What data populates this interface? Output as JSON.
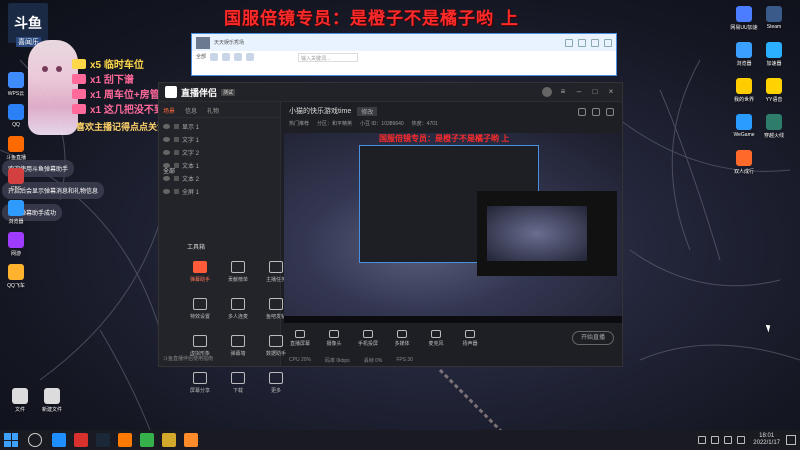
{
  "banner": {
    "text": "国服倍镜专员：是橙子不是橘子哟    上"
  },
  "overlay": {
    "logo": "斗鱼",
    "logo_sub": "喜闻乐",
    "lines": [
      {
        "text": "x5 临时车位",
        "color": "#ffd84a",
        "icon": "gift-icon"
      },
      {
        "text": "x1 刮下谱",
        "color": "#ff6a9a",
        "icon": "gift-icon"
      },
      {
        "text": "x1 周车位+房管",
        "color": "#ff6a9a",
        "icon": "gift-icon"
      },
      {
        "text": "x1 这几把没不到吖",
        "color": "#ff6a9a",
        "icon": "gift-icon"
      }
    ],
    "follow": "喜欢主播记得点点关注呦~❤"
  },
  "chat_bubbles": [
    "欢迎使用斗鱼弹幕助手",
    "开启后会显示弹幕消息和礼物信息",
    "添加弹幕助手成功"
  ],
  "desktop_left": [
    {
      "label": "WPS云",
      "color": "#3f8cff"
    },
    {
      "label": "QQ",
      "color": "#2b80f5"
    },
    {
      "label": "斗鱼直播",
      "color": "#ff6a00"
    },
    {
      "label": "CBS",
      "color": "#d24040"
    },
    {
      "label": "浏览器",
      "color": "#2e9cff"
    },
    {
      "label": "网游",
      "color": "#a03cff"
    },
    {
      "label": "QQ飞车",
      "color": "#ffb22e"
    }
  ],
  "desktop_right": [
    {
      "label": "网易UU加速",
      "color": "#4a7dff"
    },
    {
      "label": "Steam",
      "color": "#3a5a8a"
    },
    {
      "label": "浏览器",
      "color": "#3aa0ff"
    },
    {
      "label": "加速器",
      "color": "#2bb0ff"
    },
    {
      "label": "我的世界",
      "color": "#ffcc00"
    },
    {
      "label": "YY语音",
      "color": "#ffd200"
    },
    {
      "label": "WeGame",
      "color": "#2a9cff"
    },
    {
      "label": "穿越火线",
      "color": "#2e7d6a"
    },
    {
      "label": "双人成行",
      "color": "#ff6a2a"
    }
  ],
  "desktop_bottom": [
    {
      "label": "文件",
      "color": "#dcdcdc"
    },
    {
      "label": "新建文件",
      "color": "#dcdcdc"
    }
  ],
  "fish": {
    "title": "天天娱乐秀场",
    "search_placeholder": "输入关键词...",
    "label_tool": "全部"
  },
  "app": {
    "name": "直播伴侣",
    "version": "测试",
    "left_tabs": [
      "场景",
      "信息",
      "礼物"
    ],
    "scenes": [
      "显示 1",
      "文字 1",
      "文字 2",
      "文本 1",
      "文本 2",
      "全屏 1"
    ],
    "full_label": "全部",
    "tools_head": "工具箱",
    "tools": [
      {
        "label": "弹幕助手",
        "red": true
      },
      {
        "label": "贡献榜单",
        "red": false
      },
      {
        "label": "主播任务",
        "red": false
      },
      {
        "label": "特效设置",
        "red": false
      },
      {
        "label": "多人连麦",
        "red": false
      },
      {
        "label": "鱼吧发帖",
        "red": false
      },
      {
        "label": "虚拟形象",
        "red": false
      },
      {
        "label": "弹幕墙",
        "red": false
      },
      {
        "label": "数据助手",
        "red": false
      },
      {
        "label": "屏幕分享",
        "red": false
      },
      {
        "label": "下载",
        "red": false
      },
      {
        "label": "更多",
        "red": false
      }
    ],
    "left_footer": "斗鱼直播伴侣使用指南",
    "room_title": "小猫的快乐游戏time",
    "room_tag": "修改",
    "room_meta": [
      "热门推荐",
      "分区：和平精英",
      "小豆 ID：10389640",
      "热度：4701"
    ],
    "bottom_items": [
      "直播屏幕",
      "摄像头",
      "手机投屏",
      "多媒体",
      "麦克风",
      "扬声器"
    ],
    "live_button": "开始直播",
    "status": [
      "CPU 20%",
      "码率 0kbps",
      "丢帧 0%",
      "FPS 30"
    ]
  },
  "taskbar": {
    "time": "18:01",
    "date": "2022/1/17",
    "apps": [
      {
        "name": "edge",
        "color": "#1f8fff"
      },
      {
        "name": "netease",
        "color": "#d9322e"
      },
      {
        "name": "steam",
        "color": "#1b2838"
      },
      {
        "name": "douyu",
        "color": "#ff7a00"
      },
      {
        "name": "app-green",
        "color": "#36b04a"
      },
      {
        "name": "app-gold",
        "color": "#d4a82b"
      },
      {
        "name": "app-orange",
        "color": "#ff8c2a"
      }
    ]
  }
}
